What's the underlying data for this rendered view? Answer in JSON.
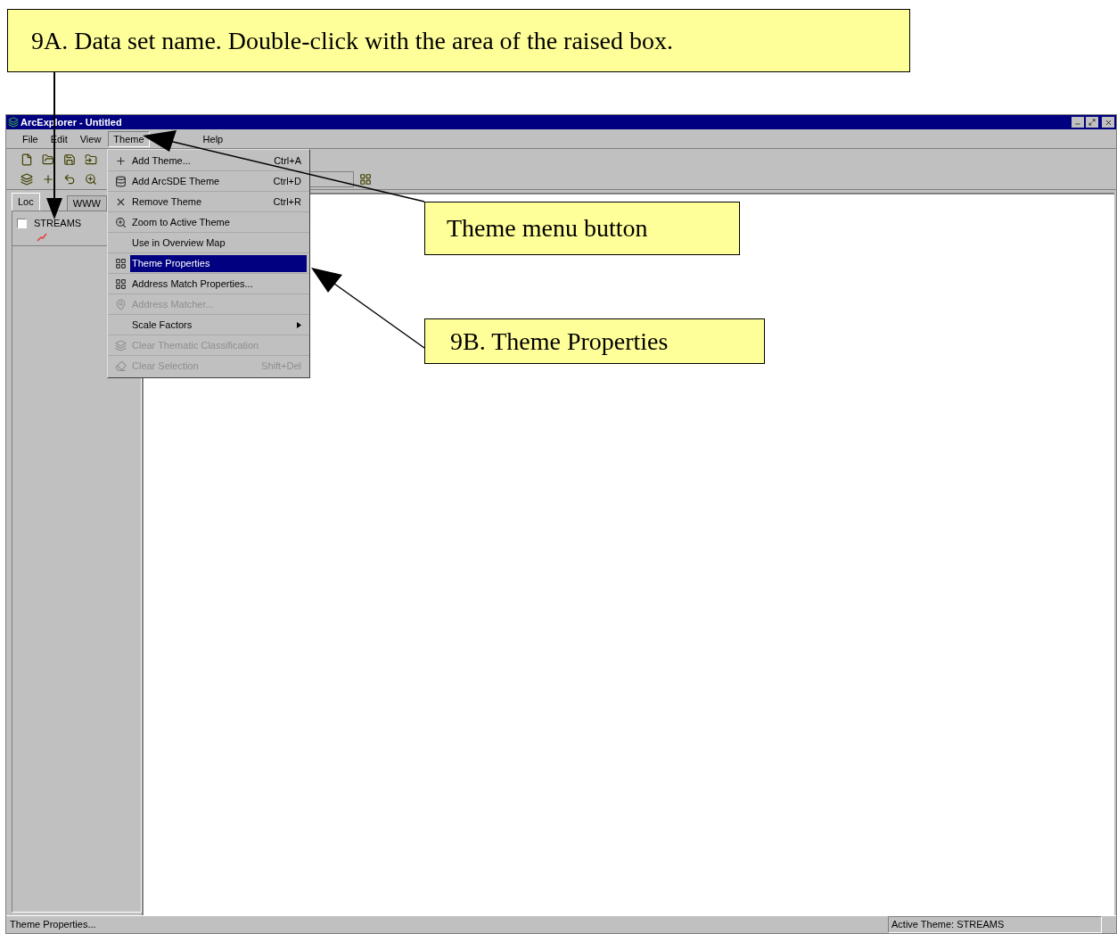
{
  "callouts": [
    {
      "text": "9A. Data set name.  Double-click with the area of the raised box."
    },
    {
      "text": "Theme menu button"
    },
    {
      "text": "9B. Theme Properties"
    }
  ],
  "window": {
    "title": "ArcExplorer - Untitled"
  },
  "menu_bar": [
    {
      "label": "File",
      "selected": false
    },
    {
      "label": "Edit",
      "selected": false
    },
    {
      "label": "View",
      "selected": false
    },
    {
      "label": "Theme",
      "selected": true
    },
    {
      "label": "Help",
      "selected": false
    }
  ],
  "theme_menu": [
    {
      "label": "Add Theme...",
      "shortcut": "Ctrl+A",
      "disabled": false,
      "selected": false,
      "submenu": false
    },
    {
      "label": "Add ArcSDE Theme",
      "shortcut": "Ctrl+D",
      "disabled": false,
      "selected": false,
      "submenu": false
    },
    {
      "label": "Remove Theme",
      "shortcut": "Ctrl+R",
      "disabled": false,
      "selected": false,
      "submenu": false
    },
    {
      "label": "Zoom to Active Theme",
      "disabled": false,
      "selected": false,
      "submenu": false
    },
    {
      "label": "Use in Overview Map",
      "disabled": false,
      "selected": false,
      "submenu": false
    },
    {
      "label": "Theme Properties",
      "disabled": false,
      "selected": true,
      "submenu": false
    },
    {
      "label": "Address Match Properties...",
      "disabled": false,
      "selected": false,
      "submenu": false
    },
    {
      "label": "Address Matcher...",
      "disabled": true,
      "selected": false,
      "submenu": false
    },
    {
      "label": "Scale Factors",
      "disabled": false,
      "selected": false,
      "submenu": true
    },
    {
      "label": "Clear Thematic Classification",
      "disabled": true,
      "selected": false,
      "submenu": false
    },
    {
      "label": "Clear Selection",
      "shortcut": "Shift+Del",
      "disabled": true,
      "selected": false,
      "submenu": false
    }
  ],
  "legend": {
    "tabs": [
      {
        "label": "Loc",
        "selected": true
      },
      {
        "label": "WWW",
        "selected": false
      }
    ],
    "themes": [
      {
        "name": "STREAMS",
        "checked": false
      }
    ]
  },
  "status_bar": {
    "message": "Theme Properties...",
    "active_theme": "Active Theme: STREAMS"
  }
}
